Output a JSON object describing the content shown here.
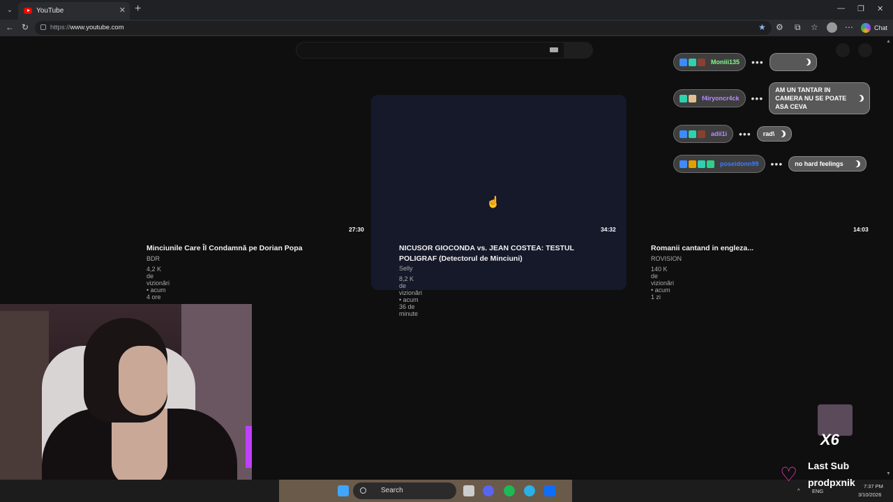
{
  "browser": {
    "tab_title": "YouTube",
    "url_scheme": "https://",
    "url_host": "www.youtube.com",
    "chat_label": "Chat"
  },
  "videos": [
    {
      "title": "Minciunile Care Îl Condamnă pe Dorian Popa",
      "channel": "BDR",
      "meta": "4,2 K de vizionări • acum 4 ore",
      "duration": "27:30"
    },
    {
      "title": "NICUSOR GIOCONDA vs. JEAN COSTEA: TESTUL POLIGRAF (Detectorul de Minciuni)",
      "channel": "Selly",
      "meta": "8,2 K de vizionări • acum 36 de minute",
      "duration": "34:32"
    },
    {
      "title": "Romanii cantand in engleza...",
      "channel": "ROVISION",
      "meta": "140 K de vizionări • acum 1 zi",
      "duration": "14:03"
    }
  ],
  "chat": [
    {
      "user": "Moniii135",
      "user_color": "#7CFC8A",
      "message": ""
    },
    {
      "user": "f4iryoncr4ck",
      "user_color": "#b98cff",
      "message": "AM UN TANTAR IN CAMERA NU SE POATE ASA CEVA"
    },
    {
      "user": "adii1i",
      "user_color": "#b98cff",
      "message": "rad\\"
    },
    {
      "user": "poseidonn99",
      "user_color": "#3d7bff",
      "message": "no hard feelings"
    }
  ],
  "overlay": {
    "multiplier": "X6",
    "last_sub_label": "Last Sub",
    "last_sub_name": "prodpxnik"
  },
  "taskbar": {
    "search_label": "Search",
    "lang": "ENG",
    "time": "7:37 PM",
    "date": "3/10/2026"
  }
}
